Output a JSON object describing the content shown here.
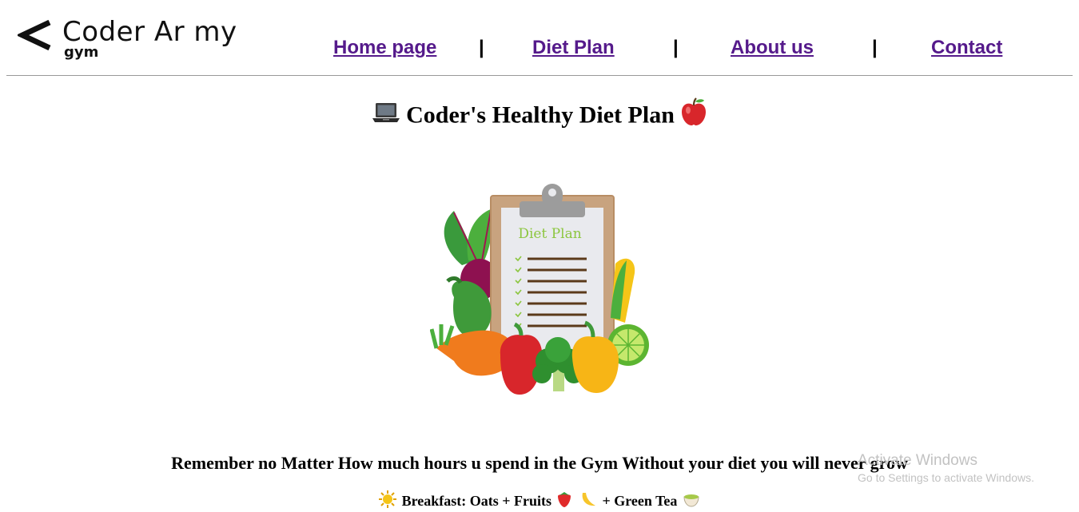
{
  "logo": {
    "brand": "Coder Ar my",
    "sub": "gym"
  },
  "nav": {
    "items": [
      {
        "label": "Home page"
      },
      {
        "label": "Diet Plan"
      },
      {
        "label": "About us"
      },
      {
        "label": "Contact"
      }
    ],
    "separator": "|"
  },
  "main": {
    "title": "Coder's Healthy Diet Plan",
    "title_icons": [
      "laptop-icon",
      "apple-icon"
    ],
    "illustration": {
      "heading": "Diet Plan"
    },
    "quote": "Remember no Matter How much hours u spend in the Gym Without your diet you will never grow",
    "meal": {
      "breakfast_text": "Breakfast: Oats + Fruits",
      "extra_text": "+ Green Tea",
      "icons": [
        "sun-icon",
        "strawberry-icon",
        "banana-icon",
        "tea-icon"
      ]
    }
  },
  "overlay": {
    "line1": "Activate Windows",
    "line2": "Go to Settings to activate Windows."
  },
  "colors": {
    "link": "#551a8b",
    "divider": "#999999",
    "watermark": "#c2c2c2"
  }
}
